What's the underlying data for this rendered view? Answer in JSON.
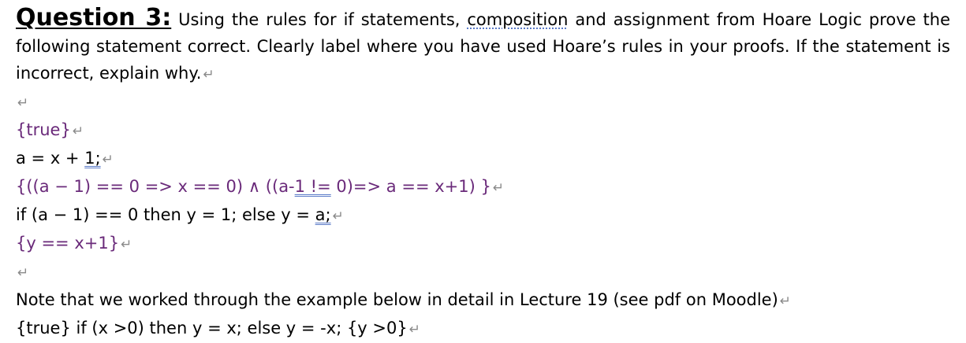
{
  "question": {
    "title": "Question 3:",
    "text_a": " Using the rules for if statements, ",
    "text_composition": "composition",
    "text_b": " and assignment from Hoare Logic prove the following statement correct. Clearly label where you have used Hoare’s rules in your proofs. If the statement is incorrect, explain why."
  },
  "paragraph_mark": "↵",
  "code": {
    "pre": "{true}",
    "assign_prefix": "a = x + ",
    "assign_value": "1;",
    "mid_a": "{((a − 1) == 0 => x == 0) ∧ ((a-",
    "mid_b": "1 !=",
    "mid_c": " 0)=> a == x+1) }",
    "if_prefix": "if (a − 1) == 0 then y = 1; else y = ",
    "if_value": "a;",
    "post": "{y == x+1}"
  },
  "note": {
    "line1": "Note that we worked through the example below in detail in Lecture 19 (see pdf on Moodle)",
    "line2": "{true} if (x >0) then y = x; else y = -x; {y >0}"
  },
  "colors": {
    "assertion": "#6a2a7a",
    "paragraph_mark": "#8a8a8a",
    "proofing_underline": "#5b7bc8"
  }
}
